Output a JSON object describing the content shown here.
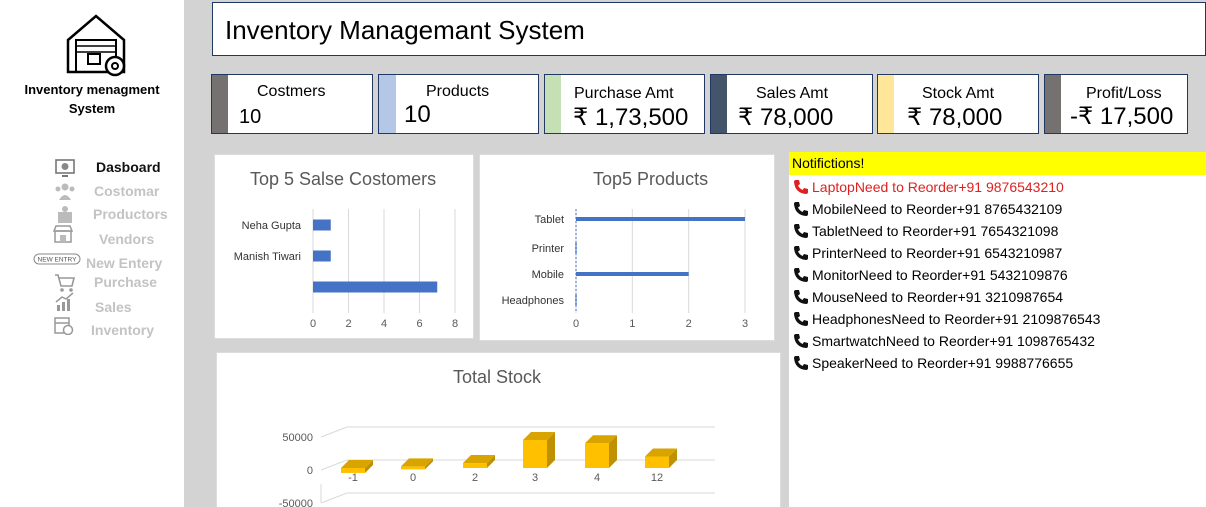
{
  "sidebar": {
    "logo_title": "Inventory menagment System",
    "items": [
      {
        "label": "Dasboard",
        "icon": "dashboard-icon",
        "active": true
      },
      {
        "label": "Costomar",
        "icon": "customers-icon",
        "active": false
      },
      {
        "label": "Productors",
        "icon": "products-icon",
        "active": false
      },
      {
        "label": "Vendors",
        "icon": "vendors-icon",
        "active": false
      },
      {
        "label": "New Entery",
        "icon": "new-entry-icon",
        "badge": "NEW ENTRY",
        "active": false
      },
      {
        "label": "Purchase",
        "icon": "cart-icon",
        "active": false
      },
      {
        "label": "Sales",
        "icon": "sales-chart-icon",
        "active": false
      },
      {
        "label": "Inventory",
        "icon": "inventory-icon",
        "active": false
      }
    ]
  },
  "header": {
    "title": "Inventory Managemant System"
  },
  "kpis": [
    {
      "label": "Costmers",
      "value": "10",
      "color": "#767171"
    },
    {
      "label": "Products",
      "value": "10",
      "color": "#b4c7e7"
    },
    {
      "label": "Purchase Amt",
      "value": "₹ 1,73,500",
      "color": "#c5e0b4"
    },
    {
      "label": "Sales Amt",
      "value": "₹ 78,000",
      "color": "#44546a"
    },
    {
      "label": "Stock Amt",
      "value": "₹ 78,000",
      "color": "#ffe699"
    },
    {
      "label": "Profit/Loss",
      "value": "-₹ 17,500",
      "color": "#767171"
    }
  ],
  "notifications": {
    "title": "Notifictions!",
    "items": [
      {
        "text": "LaptopNeed to Reorder+91 9876543210",
        "alert": true
      },
      {
        "text": "MobileNeed to Reorder+91 8765432109",
        "alert": false
      },
      {
        "text": "TabletNeed to Reorder+91 7654321098",
        "alert": false
      },
      {
        "text": "PrinterNeed to Reorder+91 6543210987",
        "alert": false
      },
      {
        "text": "MonitorNeed to Reorder+91 5432109876",
        "alert": false
      },
      {
        "text": "MouseNeed to Reorder+91 3210987654",
        "alert": false
      },
      {
        "text": "HeadphonesNeed to Reorder+91 2109876543",
        "alert": false
      },
      {
        "text": "SmartwatchNeed to Reorder+91 1098765432",
        "alert": false
      },
      {
        "text": "SpeakerNeed to Reorder+91 9988776655",
        "alert": false
      }
    ]
  },
  "colors": {
    "bar_blue": "#4472c4",
    "bar_gold": "#ffc000",
    "accent_navy": "#1f3864"
  },
  "chart_data": [
    {
      "type": "bar",
      "orientation": "horizontal",
      "title": "Top 5 Salse Costomers",
      "categories": [
        "Neha Gupta",
        "Manish Tiwari",
        ""
      ],
      "values": [
        1,
        1,
        7
      ],
      "xlim": [
        0,
        8
      ],
      "xticks": [
        "0",
        "2",
        "4",
        "6",
        "8"
      ],
      "grid": true
    },
    {
      "type": "bar",
      "orientation": "horizontal",
      "title": "Top5 Products",
      "categories": [
        "Tablet",
        "Printer",
        "Mobile",
        "Headphones"
      ],
      "values": [
        3,
        0,
        2,
        0
      ],
      "xlim": [
        0,
        3
      ],
      "xticks": [
        "0",
        "1",
        "2",
        "3"
      ],
      "grid": true
    },
    {
      "type": "bar",
      "style": "3d-column",
      "title": "Total Stock",
      "categories": [
        "-1",
        "0",
        "2",
        "3",
        "4",
        "12"
      ],
      "values": [
        -6000,
        2000,
        6000,
        34000,
        30000,
        14000
      ],
      "ylim": [
        -50000,
        50000
      ],
      "yticks": [
        "50000",
        "0",
        "-50000"
      ],
      "grid": true
    }
  ]
}
